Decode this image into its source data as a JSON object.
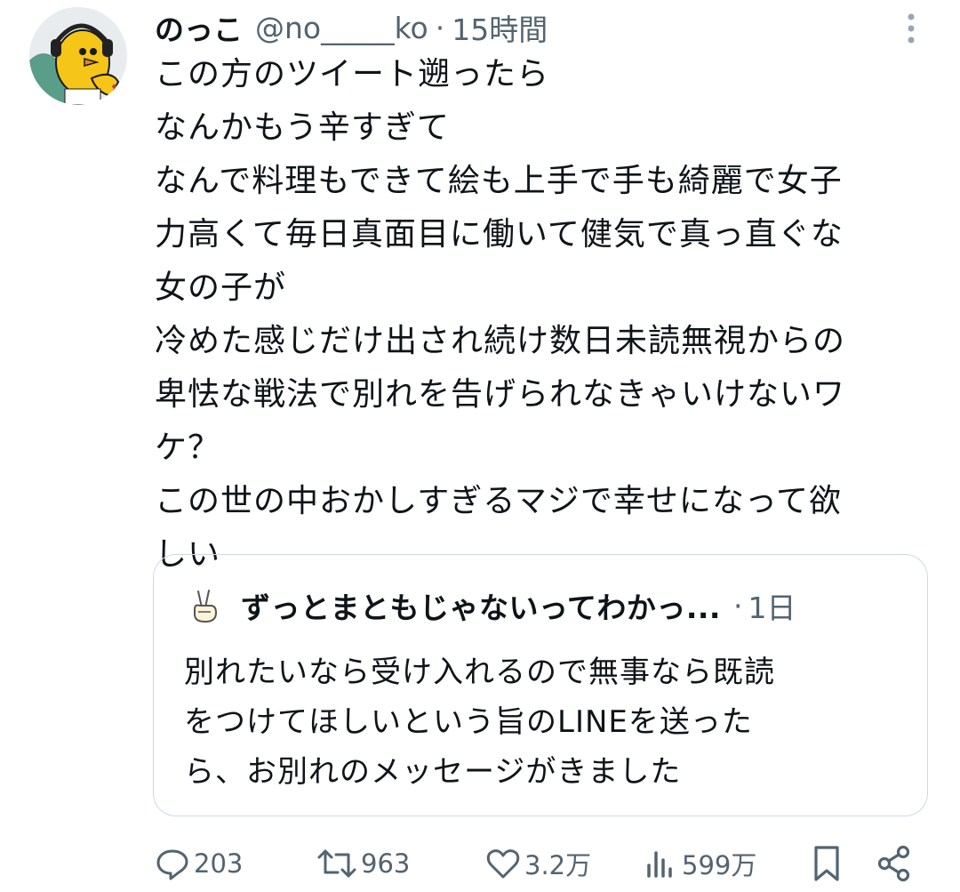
{
  "tweet": {
    "display_name": "のっこ",
    "handle": "@no_____ko",
    "separator": "·",
    "time": "15時間",
    "text": "この方のツイート遡ったら\nなんかもう辛すぎて\nなんで料理もできて絵も上手で手も綺麗で女子\n力高くて毎日真面目に働いて健気で真っ直ぐな\n女の子が\n冷めた感じだけ出され続け数日未読無視からの\n卑怯な戦法で別れを告げられなきゃいけないワ\nケ？\nこの世の中おかしすぎるマジで幸せになって欲\nしい"
  },
  "quote": {
    "display_name": "ずっとまともじゃないってわかっ...",
    "separator": "·",
    "time": "1日",
    "text": "別れたいなら受け入れるので無事なら既読\nをつけてほしいという旨のLINEを送った\nら、お別れのメッセージがきました"
  },
  "actions": {
    "replies": "203",
    "retweets": "963",
    "likes": "3.2万",
    "views": "599万"
  },
  "icons": {
    "avatar": "yellow-bird-headphones-avatar",
    "more": "more-vertical-icon",
    "quote_avatar": "peace-hand-icon",
    "reply": "reply-icon",
    "retweet": "retweet-icon",
    "like": "heart-icon",
    "views": "views-bar-icon",
    "bookmark": "bookmark-icon",
    "share": "share-icon"
  },
  "colors": {
    "text": "#0f1419",
    "secondary": "#536471",
    "border": "#cfd9de",
    "avatar_bird": "#f5c518"
  }
}
